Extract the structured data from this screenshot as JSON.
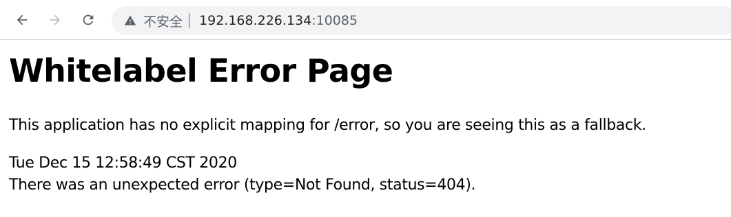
{
  "browser": {
    "security_label": "不安全",
    "url_host": "192.168.226.134",
    "url_port": ":10085"
  },
  "page": {
    "title": "Whitelabel Error Page",
    "message": "This application has no explicit mapping for /error, so you are seeing this as a fallback.",
    "timestamp": "Tue Dec 15 12:58:49 CST 2020",
    "error_detail": "There was an unexpected error (type=Not Found, status=404)."
  },
  "icons": {
    "back": "arrow-left-icon",
    "forward": "arrow-right-icon",
    "reload": "reload-icon",
    "security": "warning-triangle-icon"
  },
  "colors": {
    "toolbar_icon": "#5f6368",
    "disabled_icon": "#bdc1c6",
    "omnibox_bg": "#f1f3f4"
  }
}
